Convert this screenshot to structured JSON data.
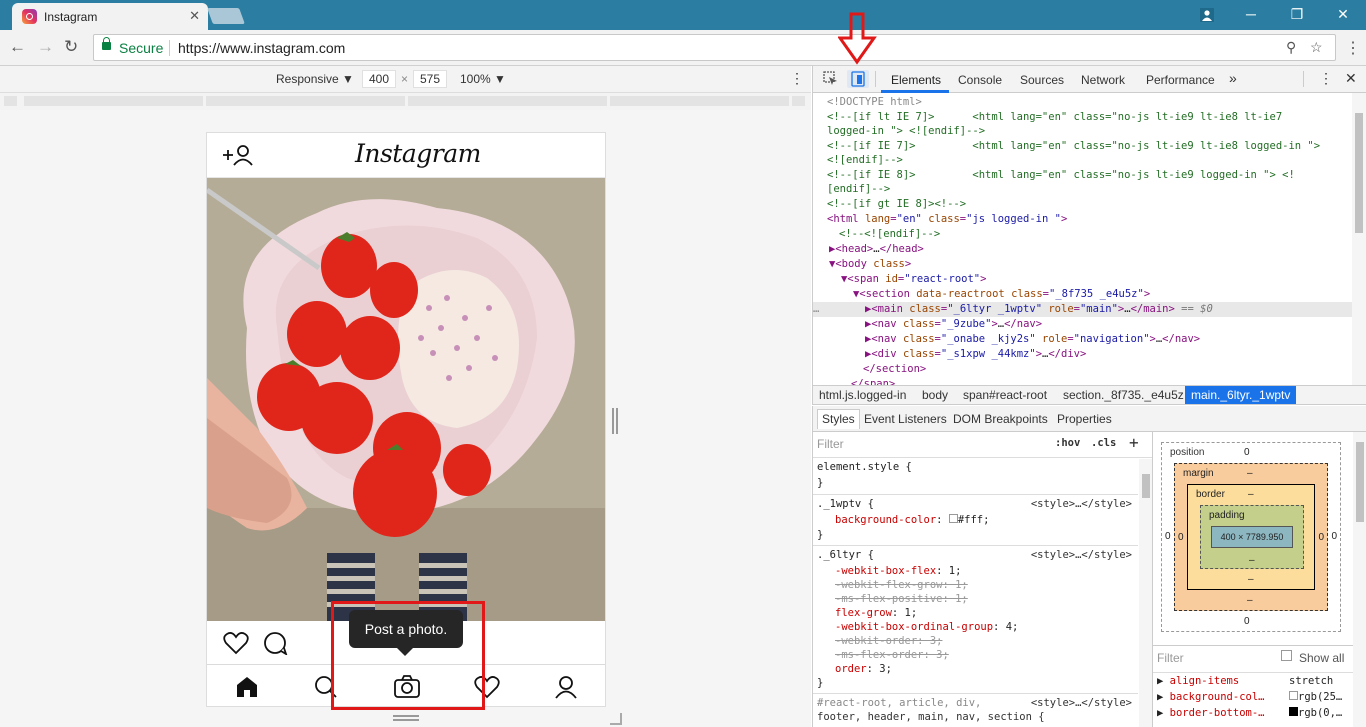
{
  "browser": {
    "tab_title": "Instagram",
    "secure_label": "Secure",
    "url": "https://www.instagram.com"
  },
  "device_toolbar": {
    "mode": "Responsive",
    "width": "400",
    "times": "×",
    "height": "575",
    "zoom": "100%"
  },
  "instagram": {
    "logo": "Instagram",
    "tooltip": "Post a photo."
  },
  "devtools": {
    "tabs": [
      "Elements",
      "Console",
      "Sources",
      "Network",
      "Performance"
    ],
    "more": "»",
    "breadcrumbs": [
      "html.js.logged-in",
      "body",
      "span#react-root",
      "section._8f735._e4u5z",
      "main._6ltyr._1wptv"
    ],
    "subtabs": [
      "Styles",
      "Event Listeners",
      "DOM Breakpoints",
      "Properties"
    ],
    "filter_placeholder": "Filter",
    "hov": ":hov",
    "cls": ".cls",
    "box": {
      "position_label": "position",
      "position_value": "0",
      "margin_label": "margin",
      "border_label": "border",
      "padding_label": "padding",
      "dash": "–",
      "zero": "0",
      "content": "400 × 7789.950"
    },
    "computed": {
      "filter": "Filter",
      "show_all": "Show all",
      "rows": [
        {
          "prop": "align-items",
          "value": "stretch"
        },
        {
          "prop": "background-col…",
          "value": "rgb(25…"
        },
        {
          "prop": "border-bottom-…",
          "value": "rgb(0,…"
        }
      ]
    }
  }
}
